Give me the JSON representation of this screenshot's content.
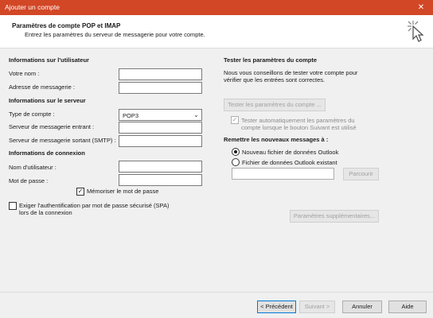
{
  "window": {
    "title": "Ajouter un compte",
    "close_glyph": "✕"
  },
  "header": {
    "title": "Paramètres de compte POP et IMAP",
    "subtitle": "Entrez les paramètres du serveur de messagerie pour votre compte."
  },
  "user_info": {
    "heading": "Informations sur l'utilisateur",
    "name_label": "Votre nom :",
    "name_value": "",
    "email_label": "Adresse de messagerie :",
    "email_value": ""
  },
  "server_info": {
    "heading": "Informations sur le serveur",
    "account_type_label": "Type de compte :",
    "account_type_value": "POP3",
    "incoming_label": "Serveur de messagerie entrant :",
    "incoming_value": "",
    "outgoing_label": "Serveur de messagerie sortant (SMTP) :",
    "outgoing_value": ""
  },
  "logon_info": {
    "heading": "Informations de connexion",
    "username_label": "Nom d'utilisateur :",
    "username_value": "",
    "password_label": "Mot de passe :",
    "password_value": "",
    "remember_label": "Mémoriser le mot de passe",
    "remember_checked": true,
    "spa_label_line1": "Exiger l'authentification par mot de passe sécurisé (SPA)",
    "spa_label_line2": "lors de la connexion",
    "spa_checked": false
  },
  "test_settings": {
    "heading": "Tester les paramètres du compte",
    "desc_line1": "Nous vous conseillons de tester votre compte pour",
    "desc_line2": "vérifier que les entrées sont correctes.",
    "test_button": "Tester les paramètres du compte ...",
    "auto_test_line1": "Tester automatiquement les paramètres du",
    "auto_test_line2": "compte lorsque le bouton Suivant est utilisé",
    "auto_test_checked": true
  },
  "deliver": {
    "heading": "Remettre les nouveaux messages à :",
    "option_new": "Nouveau fichier de données Outlook",
    "option_existing": "Fichier de données Outlook existant",
    "selected": "new",
    "existing_path": "",
    "browse_button": "Parcourir"
  },
  "more_settings_button": "Paramètres supplémentaires...",
  "footer": {
    "back": "< Précédent",
    "next": "Suivant >",
    "cancel": "Annuler",
    "help": "Aide"
  },
  "colors": {
    "titlebar": "#d24726",
    "accent": "#0078d7"
  },
  "icons": {
    "header": "cursor-click-icon",
    "close": "close-icon",
    "dropdown": "chevron-down-icon"
  }
}
